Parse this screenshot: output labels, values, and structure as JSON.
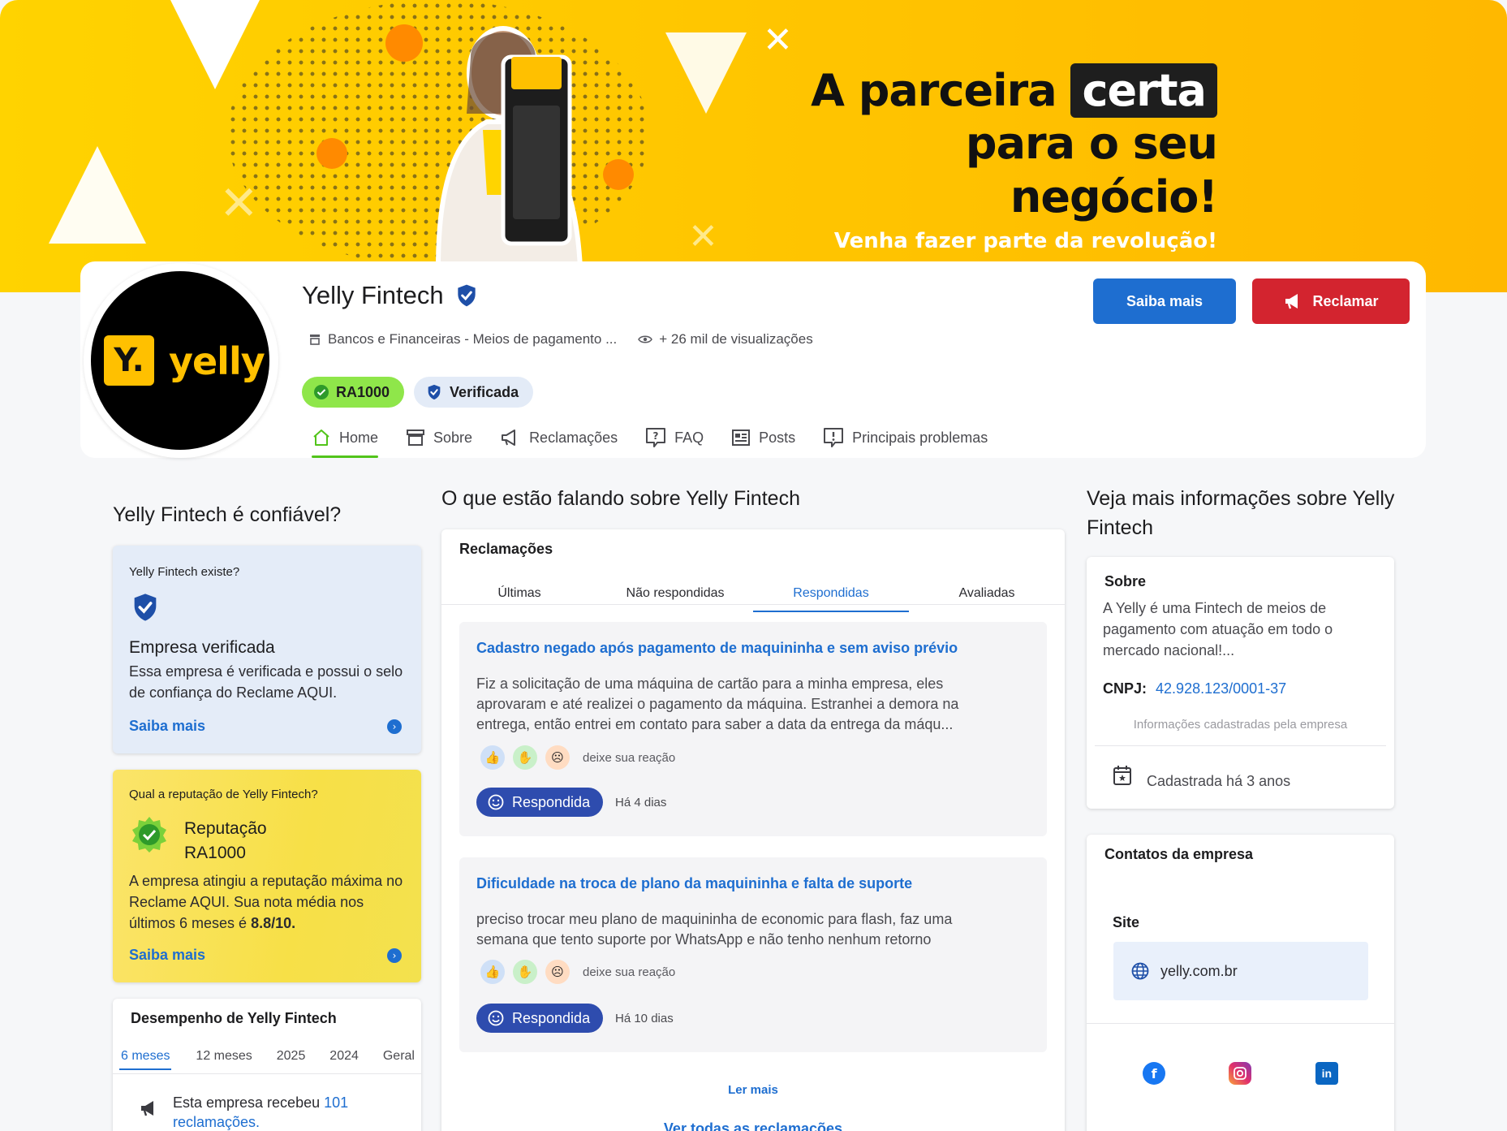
{
  "banner": {
    "headline_part1": "A parceira",
    "headline_highlight": "certa",
    "headline_line2": "para o seu negócio!",
    "subline": "Venha fazer parte da revolução!"
  },
  "profile": {
    "logo_mark": "Y.",
    "logo_text": "yelly",
    "name": "Yelly Fintech",
    "category": "Bancos e Financeiras - Meios de pagamento ...",
    "views": "+ 26 mil de visualizações",
    "badge_ra": "RA1000",
    "badge_verified": "Verificada",
    "btn_saiba": "Saiba mais",
    "btn_reclamar": "Reclamar"
  },
  "tabs": [
    {
      "label": "Home",
      "icon": "home-icon"
    },
    {
      "label": "Sobre",
      "icon": "store-icon"
    },
    {
      "label": "Reclamações",
      "icon": "megaphone-icon"
    },
    {
      "label": "FAQ",
      "icon": "question-icon"
    },
    {
      "label": "Posts",
      "icon": "newspaper-icon"
    },
    {
      "label": "Principais problemas",
      "icon": "alert-icon"
    }
  ],
  "left": {
    "title": "Yelly Fintech é confiável?",
    "verify": {
      "question": "Yelly Fintech existe?",
      "heading": "Empresa verificada",
      "text": "Essa empresa é verificada e possui o selo de confiança do Reclame AQUI.",
      "link": "Saiba mais"
    },
    "reputation": {
      "question": "Qual a reputação de Yelly Fintech?",
      "heading_line1": "Reputação",
      "heading_line2": "RA1000",
      "text": "A empresa atingiu a reputação máxima no Reclame AQUI. Sua nota média nos últimos 6 meses é",
      "score": "8.8/10.",
      "link": "Saiba mais"
    },
    "performance": {
      "title": "Desempenho de Yelly Fintech",
      "periods": [
        "6 meses",
        "12 meses",
        "2025",
        "2024",
        "Geral"
      ],
      "received_prefix": "Esta empresa recebeu",
      "received_count": "101",
      "received_suffix": "reclamações."
    }
  },
  "middle": {
    "title": "O que estão falando sobre Yelly Fintech",
    "card_title": "Reclamações",
    "tabs": [
      "Últimas",
      "Não respondidas",
      "Respondidas",
      "Avaliadas"
    ],
    "complaints": [
      {
        "title": "Cadastro negado após pagamento de maquininha e sem aviso prévio",
        "description": "Fiz a solicitação de uma máquina de cartão para a minha empresa, eles aprovaram e até realizei o pagamento da máquina. Estranhei a demora na entrega, então entrei em contato para saber a data da entrega da máqu...",
        "reaction_label": "deixe sua reação",
        "status": "Respondida",
        "time": "Há 4 dias"
      },
      {
        "title": "Dificuldade na troca de plano da maquininha e falta de suporte",
        "description": "preciso trocar meu plano de maquininha de economic para flash, faz uma semana que tento suporte por WhatsApp e não tenho nenhum retorno",
        "reaction_label": "deixe sua reação",
        "status": "Respondida",
        "time": "Há 10 dias"
      }
    ],
    "read_more": "Ler mais",
    "see_all": "Ver todas as reclamações"
  },
  "right": {
    "title": "Veja mais informações sobre Yelly Fintech",
    "about": {
      "heading": "Sobre",
      "text": "A Yelly é uma Fintech de meios de pagamento com atuação em todo o mercado nacional!...",
      "cnpj_label": "CNPJ:",
      "cnpj_value": "42.928.123/0001-37",
      "note": "Informações cadastradas pela empresa",
      "registered": "Cadastrada há 3 anos"
    },
    "contacts": {
      "heading": "Contatos da empresa",
      "site_label": "Site",
      "site_value": "yelly.com.br"
    }
  },
  "colors": {
    "accent_blue": "#1e6ed0",
    "danger_red": "#d3242f",
    "brand_yellow": "#ffc000",
    "ra_green": "#8fe64a"
  }
}
